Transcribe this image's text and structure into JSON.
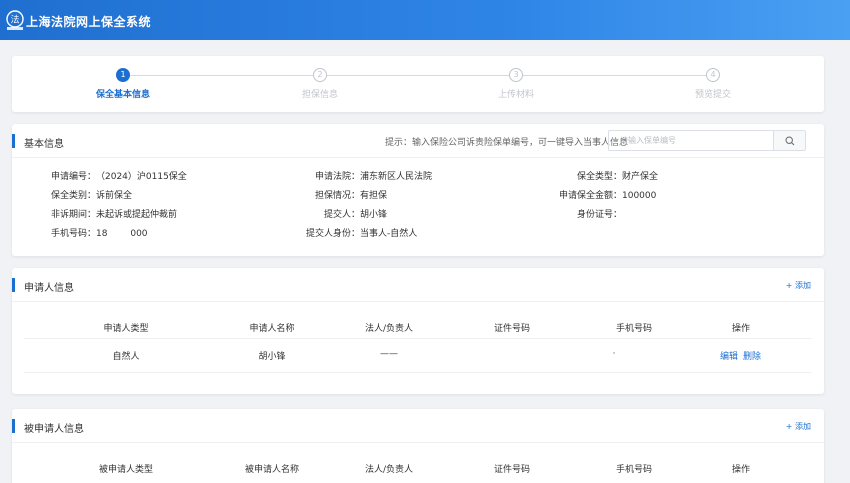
{
  "header": {
    "title": "上海法院网上保全系统"
  },
  "steps": [
    {
      "num": "1",
      "label": "保全基本信息",
      "active": true
    },
    {
      "num": "2",
      "label": "担保信息",
      "active": false
    },
    {
      "num": "3",
      "label": "上传材料",
      "active": false
    },
    {
      "num": "4",
      "label": "预览提交",
      "active": false
    }
  ],
  "basic": {
    "title": "基本信息",
    "hint": "提示：输入保险公司诉责险保单编号，可一键导入当事人信息",
    "search_placeholder": "请输入保单编号",
    "fields": {
      "app_no_label": "申请编号：",
      "app_no_value": "（2024）沪0115保全",
      "court_label": "申请法院：",
      "court_value": "浦东新区人民法院",
      "type_label": "保全类型：",
      "type_value": "财产保全",
      "category_label": "保全类别：",
      "category_value": "诉前保全",
      "guarantee_label": "担保情况：",
      "guarantee_value": "有担保",
      "amount_label": "申请保全金额：",
      "amount_value": "100000",
      "period_label": "非诉期间：",
      "period_value": "未起诉或提起仲裁前",
      "submitter_label": "提交人：",
      "submitter_value": "胡小锋",
      "id_label": "身份证号：",
      "id_value": "",
      "phone_label": "手机号码：",
      "phone_value": "18        000",
      "identity_label": "提交人身份：",
      "identity_value": "当事人-自然人"
    }
  },
  "applicant": {
    "title": "申请人信息",
    "add_label": "+ 添加",
    "headers": [
      "申请人类型",
      "申请人名称",
      "法人/负责人",
      "证件号码",
      "手机号码",
      "操作"
    ],
    "row": {
      "type": "自然人",
      "name": "胡小锋",
      "legal": "——",
      "id": "",
      "phone": "·",
      "edit": "编辑",
      "delete": "删除"
    }
  },
  "respondent": {
    "title": "被申请人信息",
    "add_label": "+ 添加",
    "headers": [
      "被申请人类型",
      "被申请人名称",
      "法人/负责人",
      "证件号码",
      "手机号码",
      "操作"
    ]
  },
  "colors": {
    "primary": "#1a6fd1",
    "header_start": "#1f6fd0",
    "header_end": "#4aa0f2"
  }
}
